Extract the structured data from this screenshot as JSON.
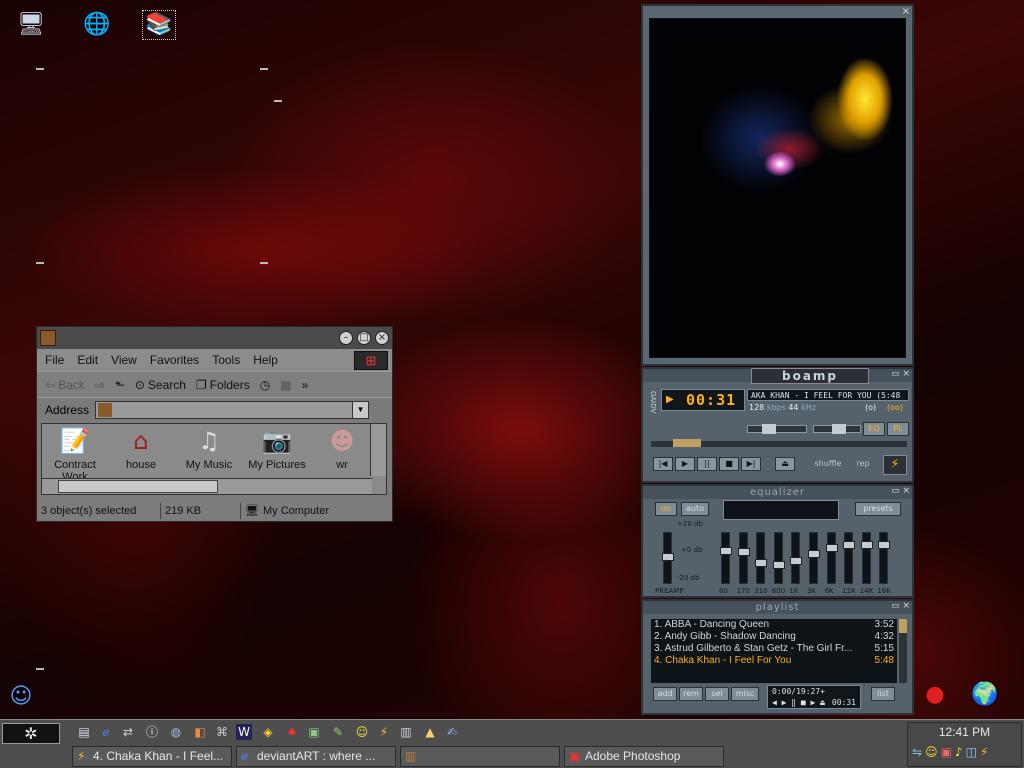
{
  "explorer": {
    "menu": [
      "File",
      "Edit",
      "View",
      "Favorites",
      "Tools",
      "Help"
    ],
    "toolbar": {
      "back": "Back",
      "search": "Search",
      "folders": "Folders",
      "chevron": "»"
    },
    "address_label": "Address",
    "items": [
      {
        "label": "Contract Work",
        "icon": "notepad-icon"
      },
      {
        "label": "house",
        "icon": "house-icon"
      },
      {
        "label": "My Music",
        "icon": "music-folder-icon"
      },
      {
        "label": "My Pictures",
        "icon": "camera-icon"
      },
      {
        "label": "wr",
        "icon": "face-thumbnail-icon"
      }
    ],
    "status": {
      "selected": "3 object(s) selected",
      "size": "219 KB",
      "location": "My Computer"
    }
  },
  "boamp": {
    "title": "boamp",
    "side_label": "OAIDV",
    "time": "00:31",
    "song_title": "AKA KHAN - I FEEL FOR YOU (5:48",
    "bitrate": "128",
    "kbps_label": "kbps",
    "khz": "44",
    "khz_label": "kHz",
    "stereo_label": "(o)",
    "mode_label": "(oo)",
    "eq_button": "EQ",
    "pl_button": "PL",
    "shuffle": "shuffle",
    "repeat": "rep"
  },
  "equalizer": {
    "title": "equalizer",
    "on": "on",
    "auto": "auto",
    "presets": "presets",
    "preamp_label": "PREAMP",
    "db_labels": [
      "+20 db",
      "+0 db",
      "-20 db"
    ],
    "bands": [
      "60",
      "170",
      "310",
      "600",
      "1K",
      "3K",
      "6K",
      "12K",
      "14K",
      "16K"
    ],
    "preamp_level": 0.55,
    "band_levels": [
      0.68,
      0.66,
      0.42,
      0.36,
      0.45,
      0.62,
      0.74,
      0.82,
      0.82,
      0.82
    ]
  },
  "playlist": {
    "title": "playlist",
    "tracks": [
      {
        "title": "1. ABBA - Dancing Queen",
        "time": "3:52"
      },
      {
        "title": "2. Andy Gibb - Shadow Dancing",
        "time": "4:32"
      },
      {
        "title": "3. Astrud Gilberto & Stan Getz  - The Girl Fr...",
        "time": "5:15"
      },
      {
        "title": "4. Chaka Khan - I Feel For You",
        "time": "5:48"
      }
    ],
    "buttons": {
      "add": "add",
      "rem": "rem",
      "sel": "sel",
      "misc": "misc",
      "list": "list"
    },
    "total": "0:00/19:27+",
    "elapsed": "00:31"
  },
  "taskbar": {
    "tasks": [
      {
        "label": "4. Chaka Khan - I Feel...",
        "icon": "winamp-bolt-icon"
      },
      {
        "label": "deviantART : where ...",
        "icon": "ie-browser-icon"
      },
      {
        "label": "",
        "icon": "library-folder-icon"
      },
      {
        "label": "Adobe Photoshop",
        "icon": "photoshop-icon"
      }
    ],
    "clock": "12:41 PM"
  }
}
